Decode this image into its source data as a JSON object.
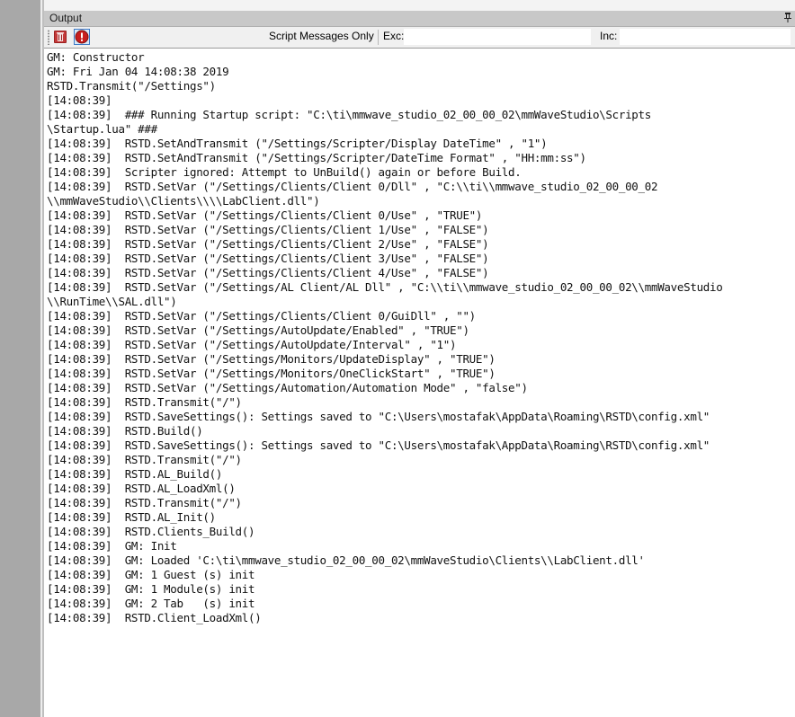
{
  "panel": {
    "title": "Output"
  },
  "toolbar": {
    "script_messages_label": "Script Messages Only",
    "exc_label": "Exc:",
    "exc_value": "",
    "inc_label": "Inc:",
    "inc_value": ""
  },
  "log": {
    "lines": [
      "GM: Constructor",
      "GM: Fri Jan 04 14:08:38 2019",
      "RSTD.Transmit(\"/Settings\")",
      "[14:08:39]",
      "[14:08:39]  ### Running Startup script: \"C:\\ti\\mmwave_studio_02_00_00_02\\mmWaveStudio\\Scripts",
      "\\Startup.lua\" ###",
      "[14:08:39]  RSTD.SetAndTransmit (\"/Settings/Scripter/Display DateTime\" , \"1\")",
      "[14:08:39]  RSTD.SetAndTransmit (\"/Settings/Scripter/DateTime Format\" , \"HH:mm:ss\")",
      "[14:08:39]  Scripter ignored: Attempt to UnBuild() again or before Build.",
      "[14:08:39]  RSTD.SetVar (\"/Settings/Clients/Client 0/Dll\" , \"C:\\\\ti\\\\mmwave_studio_02_00_00_02",
      "\\\\mmWaveStudio\\\\Clients\\\\\\\\LabClient.dll\")",
      "[14:08:39]  RSTD.SetVar (\"/Settings/Clients/Client 0/Use\" , \"TRUE\")",
      "[14:08:39]  RSTD.SetVar (\"/Settings/Clients/Client 1/Use\" , \"FALSE\")",
      "[14:08:39]  RSTD.SetVar (\"/Settings/Clients/Client 2/Use\" , \"FALSE\")",
      "[14:08:39]  RSTD.SetVar (\"/Settings/Clients/Client 3/Use\" , \"FALSE\")",
      "[14:08:39]  RSTD.SetVar (\"/Settings/Clients/Client 4/Use\" , \"FALSE\")",
      "[14:08:39]  RSTD.SetVar (\"/Settings/AL Client/AL Dll\" , \"C:\\\\ti\\\\mmwave_studio_02_00_00_02\\\\mmWaveStudio",
      "\\\\RunTime\\\\SAL.dll\")",
      "[14:08:39]  RSTD.SetVar (\"/Settings/Clients/Client 0/GuiDll\" , \"\")",
      "[14:08:39]  RSTD.SetVar (\"/Settings/AutoUpdate/Enabled\" , \"TRUE\")",
      "[14:08:39]  RSTD.SetVar (\"/Settings/AutoUpdate/Interval\" , \"1\")",
      "[14:08:39]  RSTD.SetVar (\"/Settings/Monitors/UpdateDisplay\" , \"TRUE\")",
      "[14:08:39]  RSTD.SetVar (\"/Settings/Monitors/OneClickStart\" , \"TRUE\")",
      "[14:08:39]  RSTD.SetVar (\"/Settings/Automation/Automation Mode\" , \"false\")",
      "[14:08:39]  RSTD.Transmit(\"/\")",
      "[14:08:39]  RSTD.SaveSettings(): Settings saved to \"C:\\Users\\mostafak\\AppData\\Roaming\\RSTD\\config.xml\"",
      "[14:08:39]  RSTD.Build()",
      "[14:08:39]  RSTD.SaveSettings(): Settings saved to \"C:\\Users\\mostafak\\AppData\\Roaming\\RSTD\\config.xml\"",
      "[14:08:39]  RSTD.Transmit(\"/\")",
      "[14:08:39]  RSTD.AL_Build()",
      "[14:08:39]  RSTD.AL_LoadXml()",
      "[14:08:39]  RSTD.Transmit(\"/\")",
      "[14:08:39]  RSTD.AL_Init()",
      "[14:08:39]  RSTD.Clients_Build()",
      "[14:08:39]  GM: Init",
      "[14:08:39]  GM: Loaded 'C:\\ti\\mmwave_studio_02_00_00_02\\mmWaveStudio\\Clients\\\\LabClient.dll'",
      "[14:08:39]  GM: 1 Guest (s) init",
      "[14:08:39]  GM: 1 Module(s) init",
      "[14:08:39]  GM: 2 Tab   (s) init",
      "[14:08:39]  RSTD.Client_LoadXml()"
    ]
  }
}
